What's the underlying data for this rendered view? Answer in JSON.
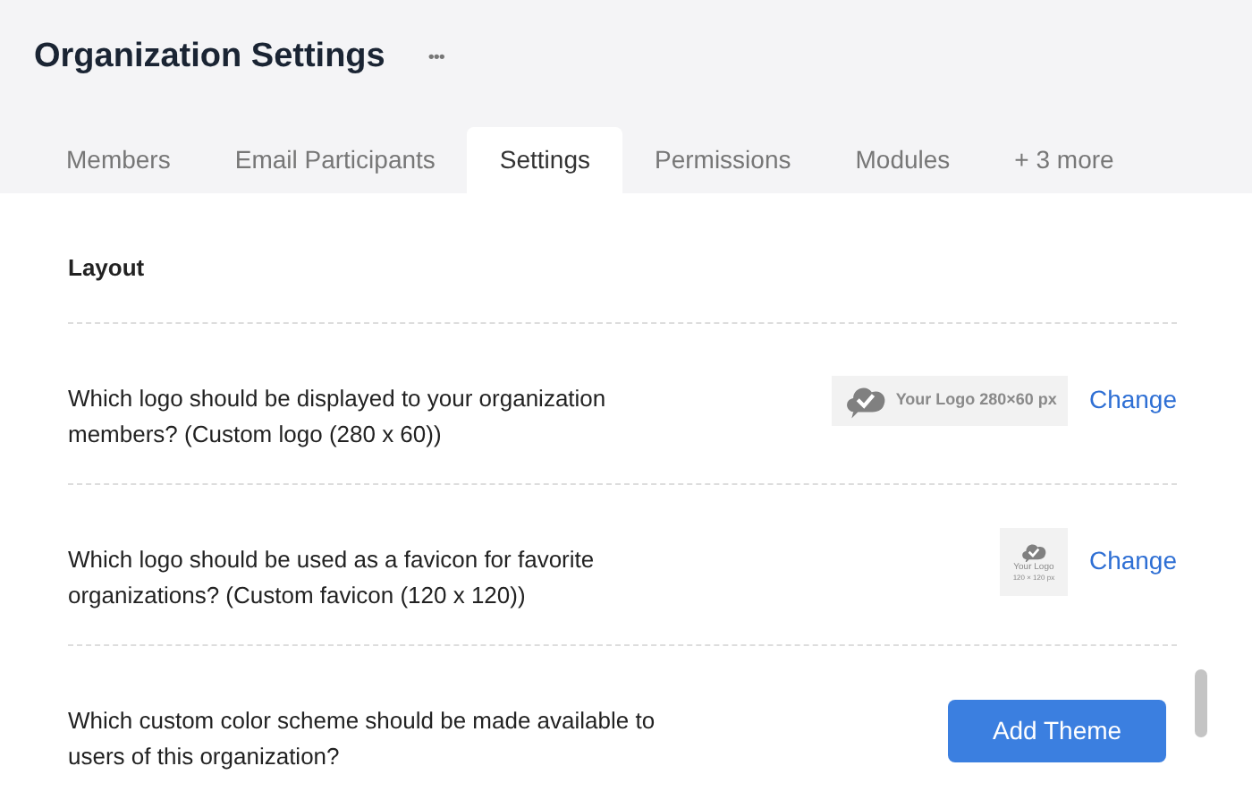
{
  "header": {
    "title": "Organization Settings",
    "more": "•••"
  },
  "tabs": [
    {
      "label": "Members",
      "selected": false
    },
    {
      "label": "Email Participants",
      "selected": false
    },
    {
      "label": "Settings",
      "selected": true
    },
    {
      "label": "Permissions",
      "selected": false
    },
    {
      "label": "Modules",
      "selected": false
    },
    {
      "label": "+ 3 more",
      "selected": false
    }
  ],
  "section": {
    "title": "Layout"
  },
  "rows": [
    {
      "kind": "logo",
      "question": "Which logo should be displayed to your organization members? (Custom logo (280 x 60))",
      "preview": [
        "Your Logo 280×60 px"
      ],
      "action": "Change"
    },
    {
      "kind": "favicon",
      "question": "Which logo should be used as a favicon for favorite organizations? (Custom favicon (120 x 120))",
      "preview": [
        "Your Logo",
        "120 × 120 px"
      ],
      "action": "Change"
    },
    {
      "kind": "theme",
      "question": "Which custom color scheme should be made available to users of this organization?",
      "action": "Add Theme"
    }
  ]
}
